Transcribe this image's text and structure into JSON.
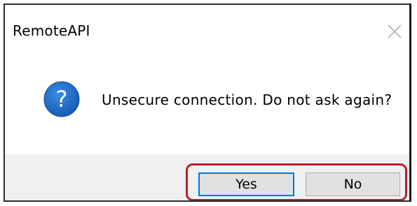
{
  "window": {
    "title": "RemoteAPI",
    "close_icon": "close-icon"
  },
  "content": {
    "icon": "question-icon",
    "icon_color": "#1f6fc7",
    "message": "Unsecure connection. Do not ask again?"
  },
  "buttons": {
    "yes_label": "Yes",
    "no_label": "No",
    "focus_color": "#0078d7",
    "highlight_color": "#b5202a"
  }
}
